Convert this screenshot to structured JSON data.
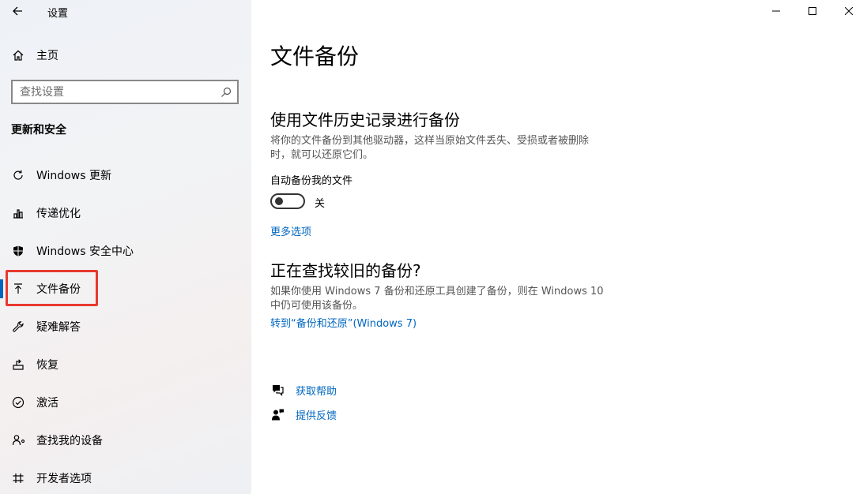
{
  "window": {
    "title": "设置",
    "controls": {
      "minimize": "minimize",
      "maximize": "maximize",
      "close": "close"
    }
  },
  "sidebar": {
    "home_label": "主页",
    "search_placeholder": "查找设置",
    "section_title": "更新和安全",
    "items": [
      {
        "label": "Windows 更新",
        "icon": "refresh-icon"
      },
      {
        "label": "传递优化",
        "icon": "delivery-optimization-icon"
      },
      {
        "label": "Windows 安全中心",
        "icon": "shield-icon"
      },
      {
        "label": "文件备份",
        "icon": "backup-arrow-icon",
        "active": true
      },
      {
        "label": "疑难解答",
        "icon": "wrench-icon"
      },
      {
        "label": "恢复",
        "icon": "recovery-icon"
      },
      {
        "label": "激活",
        "icon": "check-circle-icon"
      },
      {
        "label": "查找我的设备",
        "icon": "person-location-icon"
      },
      {
        "label": "开发者选项",
        "icon": "developer-tools-icon"
      }
    ]
  },
  "main": {
    "page_title": "文件备份",
    "file_history": {
      "heading": "使用文件历史记录进行备份",
      "description_line1": "将你的文件备份到其他驱动器，这样当原始文件丢失、受损或者被删除",
      "description_line2": "时，就可以还原它们。",
      "auto_backup_label": "自动备份我的文件",
      "toggle_state": "关",
      "toggle_on": false,
      "more_options_link": "更多选项"
    },
    "older_backup": {
      "heading": "正在查找较旧的备份?",
      "description_line1": "如果你使用 Windows 7 备份和还原工具创建了备份，则在 Windows 10",
      "description_line2": "中仍可使用该备份。",
      "link": "转到“备份和还原”(Windows 7)"
    },
    "help": {
      "get_help": "获取帮助",
      "feedback": "提供反馈"
    }
  },
  "colors": {
    "accent": "#0067c0",
    "highlight_box": "#e8392e"
  }
}
